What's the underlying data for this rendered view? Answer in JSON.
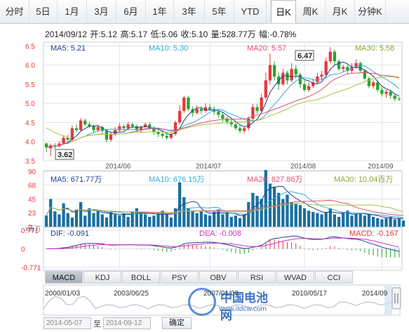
{
  "tabs": [
    {
      "label": "分时",
      "active": false
    },
    {
      "label": "5日",
      "active": false
    },
    {
      "label": "1月",
      "active": false
    },
    {
      "label": "3月",
      "active": false
    },
    {
      "label": "6月",
      "active": false
    },
    {
      "label": "1年",
      "active": false
    },
    {
      "label": "3年",
      "active": false
    },
    {
      "label": "5年",
      "active": false
    },
    {
      "label": "YTD",
      "active": false
    },
    {
      "label": "日K",
      "active": true
    },
    {
      "label": "周K",
      "active": false
    },
    {
      "label": "月K",
      "active": false
    },
    {
      "label": "分钟K",
      "active": false
    }
  ],
  "quote": {
    "date": "2014/09/12",
    "open": "开:5.12",
    "high": "高:5.17",
    "low": "低:5.06",
    "close": "收:5.10",
    "volume": "量:528.77万",
    "change": "幅:-0.78%"
  },
  "price_legend": {
    "ma5": "MA5: 5.21",
    "ma10": "MA10: 5.30",
    "ma20": "MA20: 5.57",
    "ma30": "MA30: 5.58"
  },
  "volume_legend": {
    "ma5": "MA5: 671.77万",
    "ma10": "MA10: 676.15万",
    "ma20": "MA20: 827.86万",
    "ma30": "MA30: 10.04百万"
  },
  "macd_legend": {
    "dif": "DIF: -0.091",
    "dea": "DEA: -0.008",
    "macd": "MACD: -0.167"
  },
  "indicator_tabs": [
    "MACD",
    "KDJ",
    "BOLL",
    "PSY",
    "OBV",
    "RSI",
    "WVAD",
    "CCI"
  ],
  "active_indicator": "MACD",
  "navigator": {
    "labels": [
      "2000/01/03",
      "2003/06/25",
      "2007/01/09",
      "2010/05/17",
      "2014/09"
    ]
  },
  "date_range": {
    "start": "2014-05-07",
    "to_label": "至",
    "end": "2014-09-12",
    "confirm_label": "确定"
  },
  "watermark": {
    "title": "中国电池网",
    "url": "www.itdcw.com"
  },
  "colors": {
    "up": "#e4393c",
    "down": "#2aa52a",
    "ma5": "#1f3f8f",
    "ma10": "#33aadd",
    "ma20": "#e0506a",
    "ma30": "#a8c24a",
    "vol": "#1a6fa0",
    "grid": "#dfe3e8"
  },
  "chart_data": {
    "type": "candlestick",
    "title": "",
    "x_tick_labels": [
      "2014/06",
      "2014/07",
      "2014/08",
      "2014/09"
    ],
    "price_axis": {
      "ticks": [
        3.5,
        4.0,
        4.5,
        5.0,
        5.5,
        6.0,
        6.5
      ],
      "ylim": [
        3.5,
        6.6
      ]
    },
    "annotations": {
      "high": "6.47",
      "low": "3.62"
    },
    "candles": [
      [
        3.95,
        3.85,
        3.98,
        3.72
      ],
      [
        3.82,
        3.9,
        3.95,
        3.62
      ],
      [
        3.9,
        3.88,
        3.96,
        3.8
      ],
      [
        3.88,
        3.95,
        4.0,
        3.85
      ],
      [
        3.95,
        4.1,
        4.15,
        3.92
      ],
      [
        4.1,
        4.05,
        4.18,
        4.0
      ],
      [
        4.05,
        4.35,
        4.42,
        4.02
      ],
      [
        4.35,
        4.3,
        4.45,
        4.25
      ],
      [
        4.3,
        4.55,
        4.62,
        4.28
      ],
      [
        4.55,
        4.45,
        4.6,
        4.4
      ],
      [
        4.45,
        4.4,
        4.52,
        4.35
      ],
      [
        4.4,
        4.3,
        4.45,
        4.22
      ],
      [
        4.3,
        4.38,
        4.45,
        4.25
      ],
      [
        4.38,
        4.28,
        4.42,
        4.2
      ],
      [
        4.28,
        4.05,
        4.32,
        3.98
      ],
      [
        4.05,
        4.2,
        4.25,
        4.0
      ],
      [
        4.2,
        4.3,
        4.38,
        4.15
      ],
      [
        4.3,
        4.4,
        4.48,
        4.25
      ],
      [
        4.4,
        4.35,
        4.45,
        4.3
      ],
      [
        4.35,
        4.45,
        4.52,
        4.3
      ],
      [
        4.45,
        4.4,
        4.5,
        4.35
      ],
      [
        4.4,
        4.3,
        4.45,
        4.25
      ],
      [
        4.3,
        4.38,
        4.42,
        4.22
      ],
      [
        4.38,
        4.45,
        4.5,
        4.32
      ],
      [
        4.45,
        4.35,
        4.5,
        4.3
      ],
      [
        4.35,
        4.25,
        4.4,
        4.18
      ],
      [
        4.25,
        4.2,
        4.3,
        4.12
      ],
      [
        4.2,
        4.15,
        4.28,
        4.08
      ],
      [
        4.15,
        4.1,
        4.2,
        4.05
      ],
      [
        4.1,
        4.2,
        4.25,
        4.05
      ],
      [
        4.2,
        4.5,
        4.55,
        4.15
      ],
      [
        4.5,
        4.8,
        4.95,
        4.45
      ],
      [
        4.8,
        5.15,
        5.2,
        4.75
      ],
      [
        5.15,
        4.85,
        5.2,
        4.8
      ],
      [
        4.85,
        4.75,
        4.92,
        4.65
      ],
      [
        4.75,
        4.85,
        4.95,
        4.7
      ],
      [
        4.85,
        4.8,
        4.92,
        4.72
      ],
      [
        4.8,
        4.9,
        5.0,
        4.75
      ],
      [
        4.9,
        4.85,
        4.98,
        4.8
      ],
      [
        4.85,
        4.78,
        4.92,
        4.7
      ],
      [
        4.78,
        4.7,
        4.85,
        4.62
      ],
      [
        4.7,
        4.6,
        4.75,
        4.52
      ],
      [
        4.6,
        4.52,
        4.65,
        4.45
      ],
      [
        4.52,
        4.45,
        4.58,
        4.38
      ],
      [
        4.45,
        4.35,
        4.52,
        4.3
      ],
      [
        4.35,
        4.28,
        4.42,
        4.22
      ],
      [
        4.28,
        4.35,
        4.4,
        4.22
      ],
      [
        4.35,
        4.6,
        4.65,
        4.3
      ],
      [
        4.6,
        4.9,
        4.98,
        4.55
      ],
      [
        4.9,
        4.8,
        4.98,
        4.72
      ],
      [
        4.8,
        5.15,
        5.25,
        4.78
      ],
      [
        5.15,
        5.6,
        5.8,
        5.1
      ],
      [
        5.6,
        6.0,
        6.3,
        5.5
      ],
      [
        6.0,
        5.7,
        6.1,
        5.6
      ],
      [
        5.7,
        5.5,
        5.8,
        5.35
      ],
      [
        5.5,
        5.8,
        5.9,
        5.45
      ],
      [
        5.8,
        5.6,
        5.85,
        5.5
      ],
      [
        5.6,
        5.9,
        6.05,
        5.55
      ],
      [
        5.9,
        5.75,
        6.0,
        5.65
      ],
      [
        5.75,
        5.5,
        5.8,
        5.4
      ],
      [
        5.5,
        5.35,
        5.6,
        5.3
      ],
      [
        5.35,
        5.45,
        5.55,
        5.3
      ],
      [
        5.45,
        5.55,
        5.65,
        5.4
      ],
      [
        5.55,
        5.7,
        5.8,
        5.5
      ],
      [
        5.7,
        5.75,
        5.85,
        5.6
      ],
      [
        5.75,
        6.1,
        6.2,
        5.7
      ],
      [
        6.1,
        6.35,
        6.47,
        6.05
      ],
      [
        6.35,
        6.1,
        6.4,
        6.0
      ],
      [
        6.1,
        5.9,
        6.15,
        5.85
      ],
      [
        5.9,
        5.95,
        6.0,
        5.82
      ],
      [
        5.95,
        5.85,
        6.0,
        5.78
      ],
      [
        5.85,
        5.95,
        6.05,
        5.8
      ],
      [
        5.95,
        6.05,
        6.15,
        5.9
      ],
      [
        6.05,
        5.85,
        6.1,
        5.8
      ],
      [
        5.85,
        5.65,
        5.9,
        5.6
      ],
      [
        5.65,
        5.45,
        5.7,
        5.4
      ],
      [
        5.45,
        5.55,
        5.6,
        5.38
      ],
      [
        5.55,
        5.35,
        5.6,
        5.3
      ],
      [
        5.35,
        5.25,
        5.42,
        5.18
      ],
      [
        5.25,
        5.3,
        5.35,
        5.15
      ],
      [
        5.3,
        5.2,
        5.35,
        5.12
      ],
      [
        5.2,
        5.12,
        5.25,
        5.05
      ],
      [
        5.12,
        5.1,
        5.17,
        5.06
      ]
    ],
    "volume_axis": {
      "ticks": [
        0,
        23,
        45,
        68,
        90
      ],
      "unit": "万"
    },
    "volumes": [
      18,
      45,
      25,
      20,
      38,
      22,
      15,
      28,
      40,
      18,
      30,
      22,
      26,
      20,
      15,
      24,
      20,
      18,
      22,
      16,
      24,
      30,
      22,
      20,
      16,
      18,
      22,
      26,
      20,
      15,
      30,
      72,
      48,
      30,
      25,
      22,
      25,
      20,
      18,
      24,
      28,
      20,
      22,
      16,
      18,
      14,
      20,
      40,
      55,
      50,
      45,
      92,
      70,
      65,
      55,
      45,
      52,
      40,
      38,
      35,
      30,
      26,
      24,
      22,
      20,
      24,
      30,
      20,
      16,
      22,
      26,
      18,
      20,
      22,
      18,
      20,
      16,
      14,
      12,
      14,
      16,
      12,
      14,
      10
    ],
    "macd_axis": {
      "ticks": [
        0.771,
        0,
        -0.771
      ]
    },
    "macd_series": {
      "dif": "DIF",
      "dea": "DEA",
      "macd": "MACD"
    }
  }
}
